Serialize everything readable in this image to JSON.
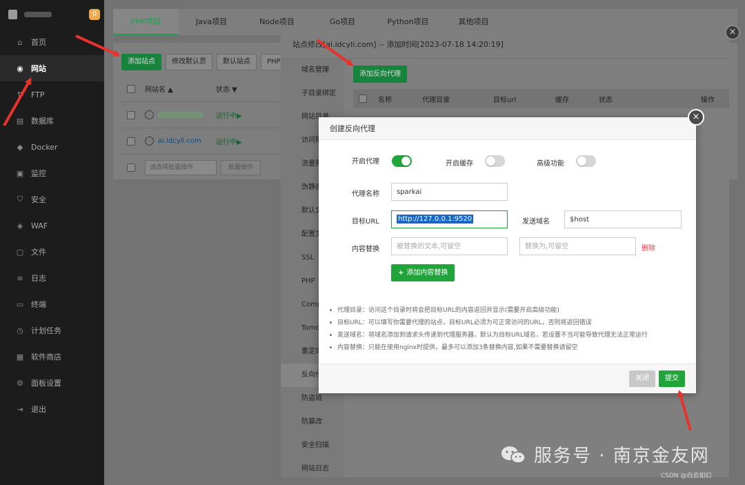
{
  "sidebar": {
    "badge": "0",
    "items": [
      {
        "label": "首页",
        "icon": "home-icon"
      },
      {
        "label": "网站",
        "icon": "globe-icon"
      },
      {
        "label": "FTP",
        "icon": "ftp-icon"
      },
      {
        "label": "数据库",
        "icon": "database-icon"
      },
      {
        "label": "Docker",
        "icon": "docker-icon"
      },
      {
        "label": "监控",
        "icon": "monitor-icon"
      },
      {
        "label": "安全",
        "icon": "shield-icon"
      },
      {
        "label": "WAF",
        "icon": "waf-icon"
      },
      {
        "label": "文件",
        "icon": "folder-icon"
      },
      {
        "label": "日志",
        "icon": "log-icon"
      },
      {
        "label": "终端",
        "icon": "terminal-icon"
      },
      {
        "label": "计划任务",
        "icon": "clock-icon"
      },
      {
        "label": "软件商店",
        "icon": "store-icon"
      },
      {
        "label": "面板设置",
        "icon": "gear-icon"
      },
      {
        "label": "退出",
        "icon": "logout-icon"
      }
    ]
  },
  "tabs": [
    "PHP项目",
    "Java项目",
    "Node项目",
    "Go项目",
    "Python项目",
    "其他项目"
  ],
  "site_panel": {
    "buttons": {
      "add_site": "添加站点",
      "edit_default": "修改默认页",
      "default_site": "默认站点",
      "php": "PHP"
    },
    "table_headers": {
      "name": "网站名 ▲",
      "status": "状态 ▼"
    },
    "rows": [
      {
        "name": "",
        "status": "运行中▶"
      },
      {
        "name": "ai.ldcyll.com",
        "status": "运行中▶"
      }
    ],
    "batch_select_placeholder": "请选择批量操作",
    "batch_button": "批量操作"
  },
  "site_modal": {
    "title": "站点修改[ai.idcyli.com] -- 添加时间[2023-07-18 14:20:19]",
    "nav": [
      "域名管理",
      "子目录绑定",
      "网站目录",
      "访问限",
      "流量限",
      "伪静态",
      "默认文",
      "配置文",
      "SSL",
      "PHP",
      "Comp",
      "Tomc",
      "重定向",
      "反向代",
      "防盗链",
      "防篡改",
      "安全扫描",
      "网站日志"
    ],
    "add_proxy_button": "添加反向代理",
    "table_headers": [
      "名称",
      "代理目录",
      "目标url",
      "缓存",
      "状态",
      "操作"
    ]
  },
  "proxy_dialog": {
    "title": "创建反向代理",
    "toggles": {
      "enable_proxy": {
        "label": "开启代理",
        "on": true
      },
      "enable_cache": {
        "label": "开启缓存",
        "on": false
      },
      "advanced": {
        "label": "高级功能",
        "on": false
      }
    },
    "proxy_name": {
      "label": "代理名称",
      "value": "sparkai"
    },
    "target_url": {
      "label": "目标URL",
      "value": "http://127.0.0.1:9520"
    },
    "send_domain": {
      "label": "发送域名",
      "value": "$host"
    },
    "content_replace": {
      "label": "内容替换",
      "from_placeholder": "被替换的文本,可留空",
      "to_placeholder": "替换为,可留空",
      "delete": "删除"
    },
    "add_replace_button": "添加内容替换",
    "notes": [
      "代理目录：访问这个目录时将会把目标URL的内容返回并显示(需要开启高级功能)",
      "目标URL：可以填写你需要代理的站点，目标URL必须为可正常访问的URL，否则将返回错误",
      "发送域名：将域名添加到请求头传递到代理服务器，默认为目标URL域名，若设置不当可能导致代理无法正常运行",
      "内容替换：只能在使用nginx时提供，最多可以添加3条替换内容,如果不需要替换请留空"
    ],
    "close_button": "关闭",
    "submit_button": "提交"
  },
  "watermark": {
    "text": "服务号 · 南京金友网",
    "csdn": "CSDN @白云如幻"
  },
  "colors": {
    "green": "#20a53a",
    "red_arrow": "#e8322c",
    "sidebar_bg": "#1c1c1c",
    "delete_red": "#e5363d"
  }
}
